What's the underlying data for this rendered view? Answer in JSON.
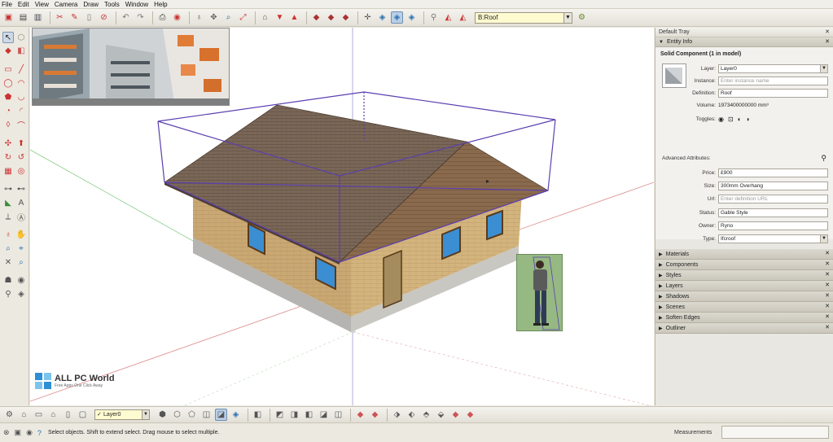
{
  "menu": [
    "File",
    "Edit",
    "View",
    "Camera",
    "Draw",
    "Tools",
    "Window",
    "Help"
  ],
  "toolbar": {
    "scene_value": "B:Roof",
    "icons": [
      "new-icon",
      "open-icon",
      "save-icon",
      "cut-icon",
      "copy-icon",
      "paste-icon",
      "erase-icon",
      "undo-icon",
      "redo-icon",
      "print-icon",
      "model-info-icon",
      "orbit-icon",
      "pan-icon",
      "zoom-icon",
      "zoom-extents-icon",
      "warehouse-icon",
      "get-models-icon",
      "share-icon",
      "x-ray-icon",
      "back-edges-icon",
      "wireframe-icon",
      "hidden-line-icon",
      "shaded-icon",
      "textured-icon",
      "monochrome-icon",
      "section-plane-icon",
      "display-section-icon",
      "section-cuts-icon",
      "add-location-icon",
      "camera-icon"
    ]
  },
  "viewport": {
    "watermark_title": "ALL PC World",
    "watermark_sub": "Free Apps One Click Away"
  },
  "tray": {
    "title": "Default Tray",
    "entity_info": {
      "header": "Entity Info",
      "title": "Solid Component (1 in model)",
      "layer_label": "Layer:",
      "layer_value": "Layer0",
      "instance_label": "Instance:",
      "instance_placeholder": "Enter instance name",
      "definition_label": "Definition:",
      "definition_value": "Roof",
      "volume_label": "Volume:",
      "volume_value": "1973400000000 mm³",
      "toggles_label": "Toggles:",
      "advanced_label": "Advanced Attributes:",
      "price_label": "Price:",
      "price_value": "£900",
      "size_label": "Size:",
      "size_value": "300mm Overhang",
      "url_label": "Url:",
      "url_placeholder": "Enter definition URL",
      "status_label": "Status:",
      "status_value": "Gable Style",
      "owner_label": "Owner:",
      "owner_value": "Ryno",
      "type_label": "Type:",
      "type_value": "Ifcroof"
    },
    "panels": [
      "Materials",
      "Components",
      "Styles",
      "Layers",
      "Shadows",
      "Scenes",
      "Soften Edges",
      "Outliner"
    ]
  },
  "bottombar": {
    "layer_value": "Layer0"
  },
  "status": {
    "text": "Select objects. Shift to extend select. Drag mouse to select multiple.",
    "measurements_label": "Measurements"
  },
  "colors": {
    "roof": "#7a6757",
    "wall": "#c9a873",
    "bbox": "#5b3fb0",
    "person_bg": "#96b882"
  }
}
